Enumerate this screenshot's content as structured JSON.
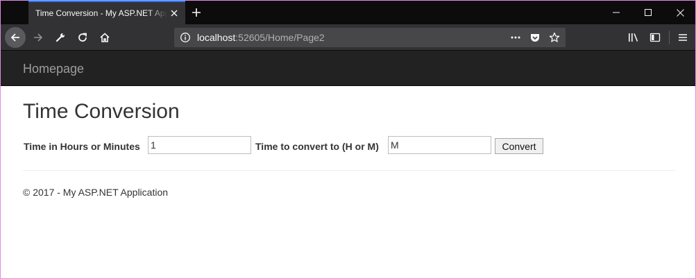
{
  "browser": {
    "tab_title": "Time Conversion - My ASP.NET Application",
    "url_host": "localhost",
    "url_rest": ":52605/Home/Page2",
    "icons": {
      "close_tab": "close-icon",
      "new_tab": "plus-icon",
      "minimize": "minimize-icon",
      "maximize": "maximize-icon",
      "close_window": "close-icon",
      "back": "arrow-left-icon",
      "forward": "arrow-right-icon",
      "tools": "wrench-icon",
      "reload": "reload-icon",
      "home": "home-icon",
      "info": "info-icon",
      "page_actions": "more-icon",
      "pocket": "pocket-icon",
      "bookmark": "star-icon",
      "library": "library-icon",
      "sidebar": "sidebar-icon",
      "menu": "hamburger-icon"
    }
  },
  "navbar": {
    "brand": "Homepage"
  },
  "main": {
    "title": "Time Conversion",
    "form": {
      "time_label": "Time in Hours or Minutes",
      "time_value": "1",
      "unit_label": "Time to convert to (H or M)",
      "unit_value": "M",
      "submit_label": "Convert"
    },
    "footer": "© 2017 - My ASP.NET Application"
  },
  "colors": {
    "tabstrip_bg": "#0c0c0d",
    "toolbar_bg": "#323234",
    "tab_accent": "#0a84ff",
    "navbar_bg": "#222222",
    "brand_text": "#9d9d9d",
    "body_text": "#333333",
    "window_border": "#e48ae6"
  }
}
